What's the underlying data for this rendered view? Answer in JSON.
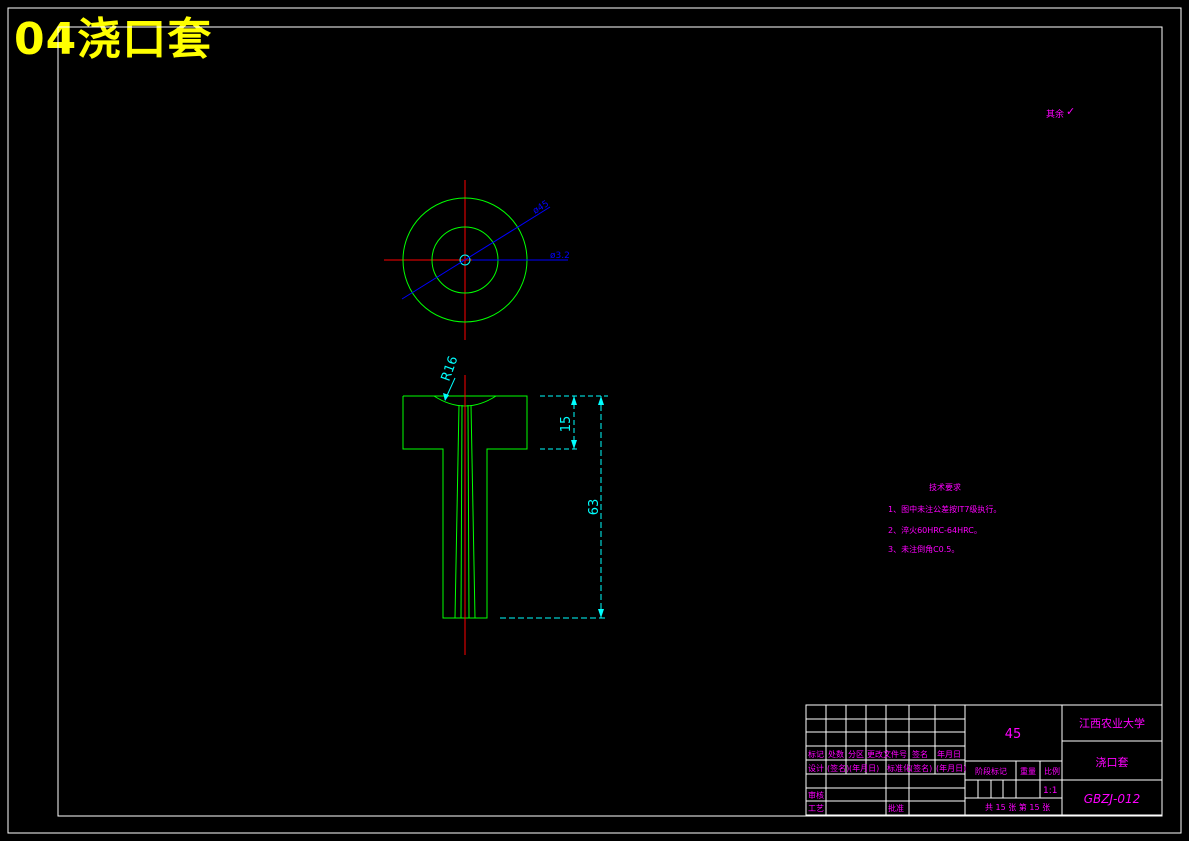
{
  "title": "04浇口套",
  "roughness_note": {
    "label": "其余",
    "symbol": "✓"
  },
  "dimensions": {
    "dia_outer": "ø45",
    "dia_hole": "ø3.2",
    "radius": "R16",
    "height_small": "15",
    "height_total": "63"
  },
  "tech_requirements": {
    "heading": "技术要求",
    "items": [
      "1、图中未注公差按IT7级执行。",
      "2、淬火60HRC-64HRC。",
      "3、未注倒角C0.5。"
    ]
  },
  "title_block": {
    "material": "45",
    "university": "江西农业大学",
    "part_name": "浇口套",
    "drawing_no": "GBZJ-012",
    "scale": "1:1",
    "sheets": "共 15 张 第 15 张",
    "headers": {
      "mark": "标记",
      "count": "处数",
      "zone": "分区",
      "change_doc": "更改文件号",
      "sign": "签名",
      "date": "年月日",
      "design": "设计",
      "sign_paren": "(签名)",
      "date_paren": "(年月日)",
      "standard": "标准化",
      "stage_mark": "阶段标记",
      "weight": "重量",
      "scale_label": "比例",
      "check": "审核",
      "process": "工艺",
      "approve": "批准"
    }
  },
  "colors": {
    "frame": "#ffffff",
    "outline": "#00ff00",
    "center": "#ff0000",
    "dimension": "#00ffff",
    "leader": "#0000ff",
    "text_magenta": "#ff00ff",
    "title": "#ffff00"
  }
}
